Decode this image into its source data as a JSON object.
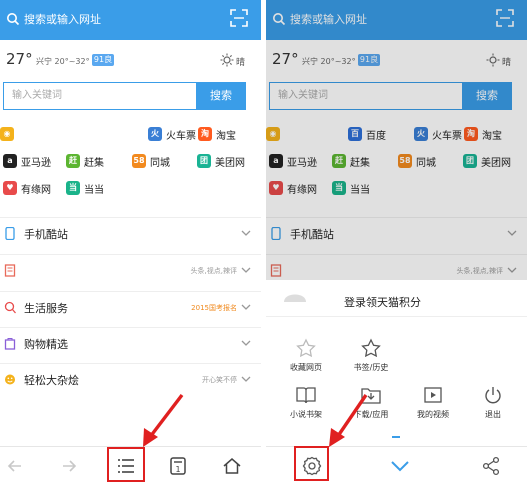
{
  "left": {
    "search_placeholder": "搜索或输入网址",
    "weather": {
      "temp": "27°",
      "location": "兴宁",
      "range": "20°~32°",
      "aqi": "91良",
      "state": "晴"
    },
    "keyword_placeholder": "输入关键词",
    "search_button": "搜索",
    "quicklinks": [
      {
        "label": "火车票",
        "icon": "train-icon",
        "color": "#3a7fd5",
        "glyph": "火"
      },
      {
        "label": "淘宝",
        "icon": "taobao-icon",
        "color": "#ff5a1f",
        "glyph": "淘"
      },
      {
        "label": "亚马逊",
        "icon": "amazon-icon",
        "color": "#222222",
        "glyph": "a"
      },
      {
        "label": "赶集",
        "icon": "ganji-icon",
        "color": "#5cb531",
        "glyph": "赶"
      },
      {
        "label": "同城",
        "icon": "58-icon",
        "color": "#f28a1f",
        "glyph": "58"
      },
      {
        "label": "美团网",
        "icon": "meituan-icon",
        "color": "#1ab394",
        "glyph": "团"
      },
      {
        "label": "有缘网",
        "icon": "youyuan-icon",
        "color": "#e84b4b",
        "glyph": "♥"
      },
      {
        "label": "当当",
        "icon": "dangdang-icon",
        "color": "#1ab38a",
        "glyph": "当"
      }
    ],
    "sections": [
      {
        "title": "手机酷站",
        "right": "",
        "icon": "phone-icon"
      },
      {
        "title": "",
        "right": "头条,视点,辣评",
        "icon": "news-icon"
      },
      {
        "title": "生活服务",
        "right": "2015国考报名",
        "icon": "life-search-icon"
      },
      {
        "title": "购物精选",
        "right": "",
        "icon": "shopping-icon"
      },
      {
        "title": "轻松大杂烩",
        "right": "开心笑不停",
        "icon": "smile-icon"
      }
    ]
  },
  "right": {
    "search_placeholder": "搜索或输入网址",
    "weather": {
      "temp": "27°",
      "location": "兴宁",
      "range": "20°~32°",
      "aqi": "91良",
      "state": "晴"
    },
    "keyword_placeholder": "输入关键词",
    "search_button": "搜索",
    "quicklinks": [
      {
        "label": "百度",
        "icon": "baidu-icon",
        "color": "#2d6fd8",
        "glyph": "百"
      },
      {
        "label": "火车票",
        "icon": "train-icon",
        "color": "#3a7fd5",
        "glyph": "火"
      },
      {
        "label": "淘宝",
        "icon": "taobao-icon",
        "color": "#ff5a1f",
        "glyph": "淘"
      },
      {
        "label": "亚马逊",
        "icon": "amazon-icon",
        "color": "#222222",
        "glyph": "a"
      },
      {
        "label": "赶集",
        "icon": "ganji-icon",
        "color": "#5cb531",
        "glyph": "赶"
      },
      {
        "label": "同城",
        "icon": "58-icon",
        "color": "#f28a1f",
        "glyph": "58"
      },
      {
        "label": "美团网",
        "icon": "meituan-icon",
        "color": "#1ab394",
        "glyph": "团"
      },
      {
        "label": "有缘网",
        "icon": "youyuan-icon",
        "color": "#e84b4b",
        "glyph": "♥"
      },
      {
        "label": "当当",
        "icon": "dangdang-icon",
        "color": "#1ab38a",
        "glyph": "当"
      }
    ],
    "sections": [
      {
        "title": "手机酷站",
        "right": "",
        "icon": "phone-icon"
      },
      {
        "title": "",
        "right": "头条,视点,辣评",
        "icon": "news-icon"
      }
    ],
    "menu": {
      "login_text": "登录领天猫积分",
      "items": [
        "收藏网页",
        "书签/历史",
        "小说书架",
        "下载/应用",
        "我的视频",
        "退出"
      ]
    }
  }
}
